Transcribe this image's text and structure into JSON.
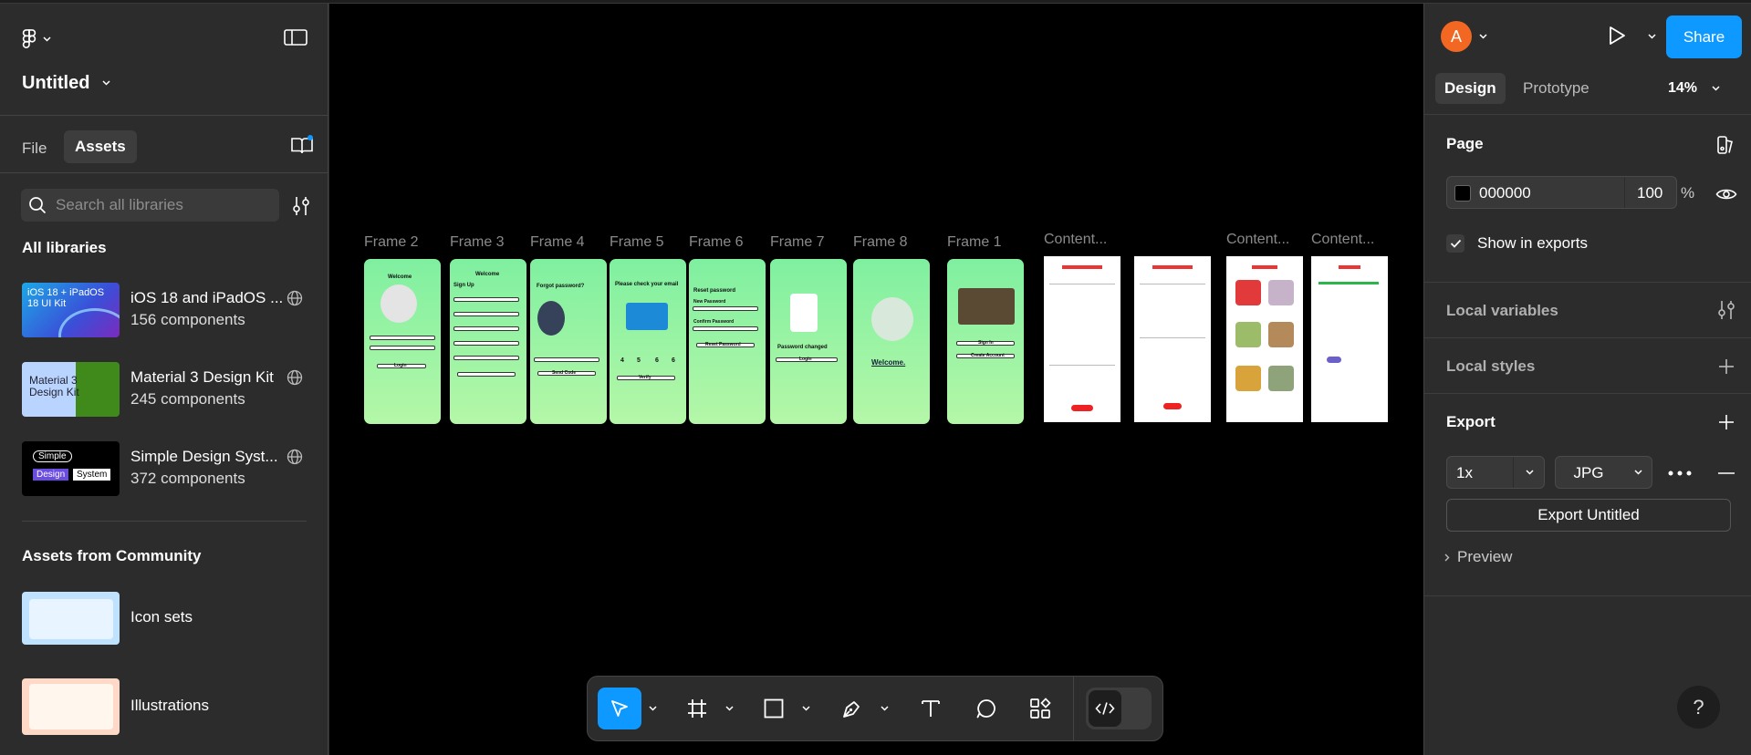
{
  "file": {
    "name": "Untitled"
  },
  "left_tabs": {
    "file": "File",
    "assets": "Assets"
  },
  "search": {
    "placeholder": "Search all libraries"
  },
  "libraries": {
    "heading": "All libraries",
    "items": [
      {
        "name": "iOS 18 and iPadOS ...",
        "count": "156 components",
        "thumb_text": "iOS 18 + iPadOS 18 UI Kit"
      },
      {
        "name": "Material 3 Design Kit",
        "count": "245 components",
        "thumb_text": "Material 3 Design Kit"
      },
      {
        "name": "Simple Design Syst...",
        "count": "372 components",
        "thumb_text": [
          "Simple",
          "Design",
          "System"
        ]
      }
    ]
  },
  "community": {
    "heading": "Assets from Community",
    "items": [
      {
        "name": "Icon sets"
      },
      {
        "name": "Illustrations"
      }
    ]
  },
  "frames": [
    {
      "label": "Frame 2",
      "title": "Welcome"
    },
    {
      "label": "Frame 3",
      "title": "Welcome"
    },
    {
      "label": "Frame 4",
      "title": "Forgot password?"
    },
    {
      "label": "Frame 5",
      "title": "Please check your email"
    },
    {
      "label": "Frame 6",
      "title": "Reset password"
    },
    {
      "label": "Frame 7",
      "title": "Password changed"
    },
    {
      "label": "Frame 8",
      "title": "Welcome."
    },
    {
      "label": "Frame 1",
      "title": ""
    },
    {
      "label": "Content...",
      "title": ""
    },
    {
      "label": "",
      "title": ""
    },
    {
      "label": "Content...",
      "title": ""
    },
    {
      "label": "Content...",
      "title": ""
    }
  ],
  "frame_texts": {
    "login": "Login",
    "sign_up": "Sign Up",
    "send_code": "Send Code",
    "verify": "Verify",
    "reset_password": "Reset Password",
    "sign_in": "Sign In",
    "create_account": "Create Account",
    "new_password": "New Password",
    "confirm_password": "Confirm Password",
    "otp": [
      "4",
      "5",
      "6",
      "6"
    ]
  },
  "toolbar": {
    "tools": [
      "move-tool",
      "frame-tool",
      "shape-tool",
      "pen-tool",
      "text-tool",
      "comment-tool",
      "assets-tool",
      "dev-mode-toggle"
    ]
  },
  "header_right": {
    "avatar_letter": "A",
    "share_label": "Share",
    "avatar_color": "#f26722",
    "share_color": "#0d99ff"
  },
  "right_tabs": {
    "design": "Design",
    "prototype": "Prototype",
    "zoom": "14%"
  },
  "page_section": {
    "title": "Page",
    "color_hex": "000000",
    "opacity": "100",
    "percent": "%",
    "show_in_exports": "Show in exports"
  },
  "local_variables": {
    "title": "Local variables"
  },
  "local_styles": {
    "title": "Local styles"
  },
  "export": {
    "title": "Export",
    "scale": "1x",
    "format": "JPG",
    "button": "Export Untitled",
    "preview": "Preview"
  },
  "help": {
    "label": "?"
  }
}
